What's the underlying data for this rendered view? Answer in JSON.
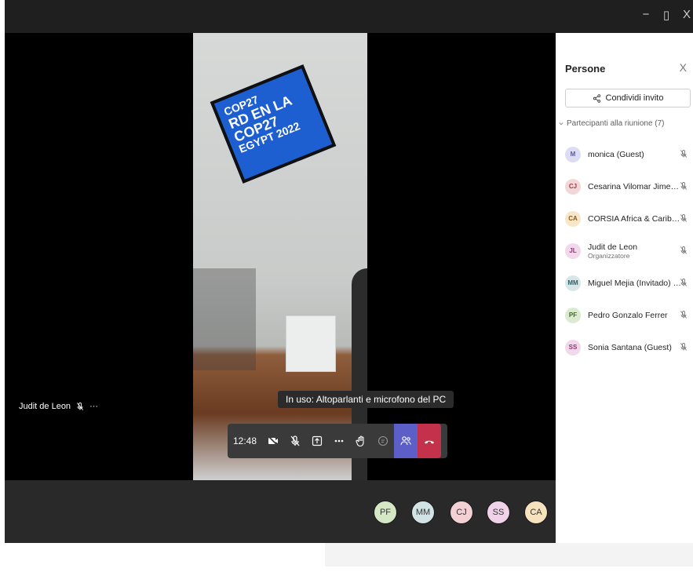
{
  "window": {
    "controls": {
      "minimize": "−",
      "restore": "▯",
      "close": "X"
    }
  },
  "video": {
    "screen_text": {
      "line1": "COP27",
      "line2": "RD EN LA",
      "line3": "COP27",
      "line4": "EGYPT 2022"
    }
  },
  "presenter": {
    "name": "Judit de Leon",
    "more": "···"
  },
  "toast": {
    "text": "In uso: Altoparlanti e microfono del PC"
  },
  "callbar": {
    "time": "12:48"
  },
  "roster": {
    "avatars": [
      {
        "initials": "PF",
        "color": "#d4e8c6"
      },
      {
        "initials": "MM",
        "color": "#d2e3e6"
      },
      {
        "initials": "CJ",
        "color": "#f3d0d3"
      },
      {
        "initials": "SS",
        "color": "#f0d3e8"
      },
      {
        "initials": "CA",
        "color": "#f6e2bd"
      }
    ]
  },
  "panel": {
    "title": "Persone",
    "close": "X",
    "invite_label": "Condividi invito",
    "section_label": "Partecipanti alla riunione (7)",
    "participants": [
      {
        "initials": "M",
        "name": "monica (Guest)",
        "role": "",
        "color": "#dcdcf5",
        "text_color": "#5a5aa0"
      },
      {
        "initials": "CJ",
        "name": "Cesarina Vilomar Jimenez",
        "role": "",
        "color": "#f3d6d8",
        "text_color": "#9c3b45"
      },
      {
        "initials": "CA",
        "name": "CORSIA Africa & Caribbean",
        "role": "",
        "color": "#f6e7c9",
        "text_color": "#8a5a12"
      },
      {
        "initials": "JL",
        "name": "Judit de Leon",
        "role": "Organizzatore",
        "color": "#f1d8ea",
        "text_color": "#8a3a73"
      },
      {
        "initials": "MM",
        "name": "Miguel Mejia (Invitado) (Gue...",
        "role": "",
        "color": "#d8e6e8",
        "text_color": "#2f5f66"
      },
      {
        "initials": "PF",
        "name": "Pedro Gonzalo Ferrer",
        "role": "",
        "color": "#dcebd0",
        "text_color": "#3f6a25"
      },
      {
        "initials": "SS",
        "name": "Sonia Santana (Guest)",
        "role": "",
        "color": "#f1d8ea",
        "text_color": "#8a3a73"
      }
    ]
  }
}
